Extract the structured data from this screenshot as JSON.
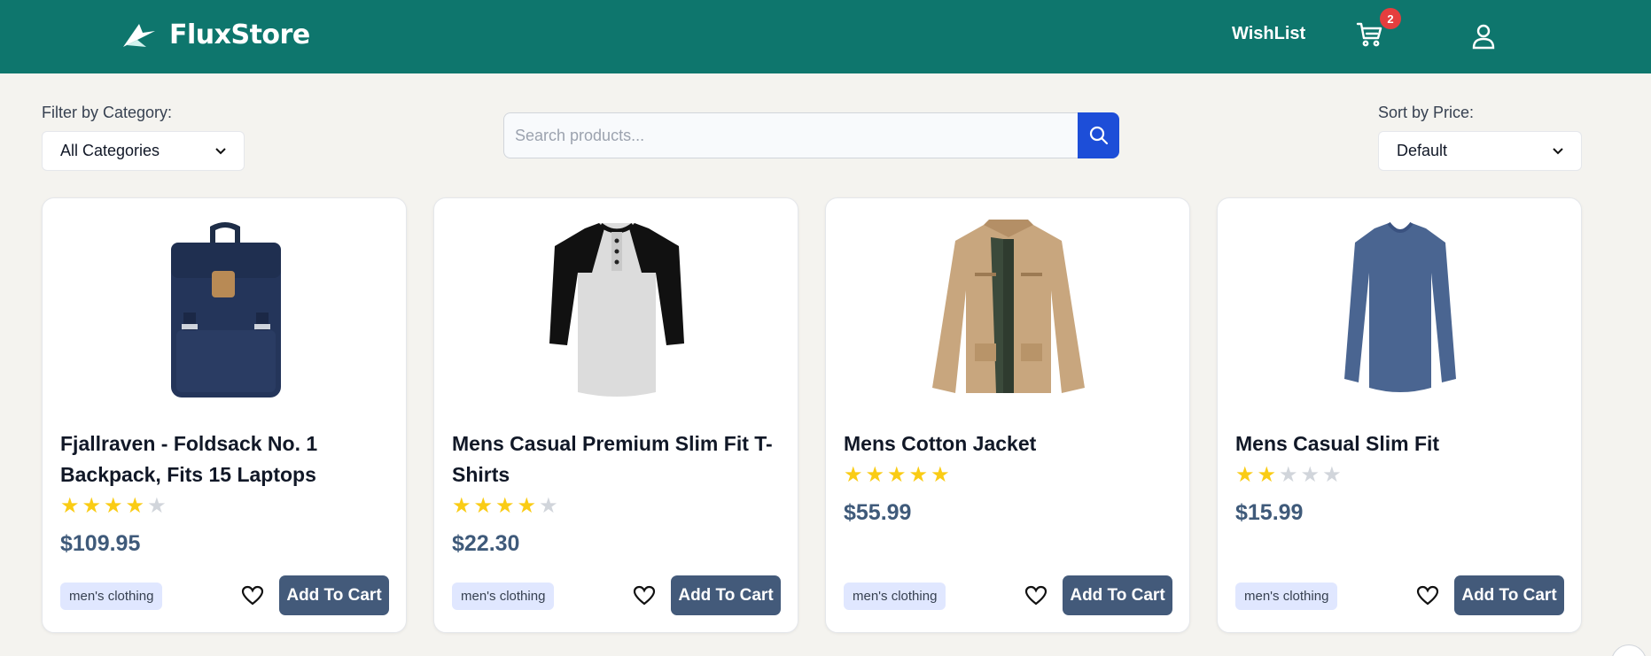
{
  "brand": {
    "name": "FluxStore",
    "header_color": "#0e766d"
  },
  "nav": {
    "wishlist_label": "WishList",
    "cart_count": "2"
  },
  "filter": {
    "label": "Filter by Category:",
    "selected": "All Categories"
  },
  "search": {
    "placeholder": "Search products..."
  },
  "sort": {
    "label": "Sort by Price:",
    "selected": "Default"
  },
  "products": [
    {
      "title": "Fjallraven - Foldsack No. 1 Backpack, Fits 15 Laptops",
      "rating": 4,
      "price": "$109.95",
      "category": "men's clothing",
      "button": "Add To Cart",
      "icon": "backpack-image"
    },
    {
      "title": "Mens Casual Premium Slim Fit T-Shirts",
      "rating": 4,
      "price": "$22.30",
      "category": "men's clothing",
      "button": "Add To Cart",
      "icon": "raglan-tshirt-image"
    },
    {
      "title": "Mens Cotton Jacket",
      "rating": 5,
      "price": "$55.99",
      "category": "men's clothing",
      "button": "Add To Cart",
      "icon": "jacket-image"
    },
    {
      "title": "Mens Casual Slim Fit",
      "rating": 2,
      "price": "$15.99",
      "category": "men's clothing",
      "button": "Add To Cart",
      "icon": "longsleeve-image"
    }
  ],
  "colors": {
    "accent": "#1d4ed8",
    "button": "#435a7a",
    "star": "#facc15"
  }
}
